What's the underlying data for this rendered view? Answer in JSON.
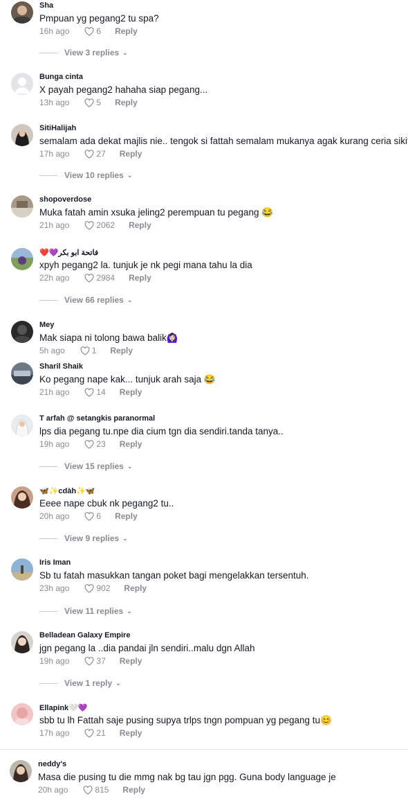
{
  "comments": [
    {
      "user": "Sha",
      "text": "Pmpuan yg pegang2 tu spa?",
      "time": "16h ago",
      "likes": "6",
      "reply": "Reply",
      "view": "View 3 replies"
    },
    {
      "user": "Bunga cinta",
      "text": "X payah pegang2 hahaha siap pegang...",
      "time": "13h ago",
      "likes": "5",
      "reply": "Reply"
    },
    {
      "user": "SitiHalijah",
      "text": "semalam ada dekat majlis nie.. tengok si fattah semalam mukanya agak kurang ceria sikit",
      "time": "17h ago",
      "likes": "27",
      "reply": "Reply",
      "view": "View 10 replies"
    },
    {
      "user": "shopoverdose",
      "text": "Muka fatah amin xsuka jeling2 perempuan tu pegang 😂",
      "time": "21h ago",
      "likes": "2062",
      "reply": "Reply"
    },
    {
      "user": "❤️💜فاتحة ابو بكر",
      "text": "xpyh pegang2 la. tunjuk je nk pegi mana tahu la dia",
      "time": "22h ago",
      "likes": "2984",
      "reply": "Reply",
      "view": "View 66 replies"
    },
    {
      "user": "Mey",
      "text": "Mak siapa ni tolong bawa balik🙆🏻‍♀️",
      "time": "5h ago",
      "likes": "1",
      "reply": "Reply"
    },
    {
      "user": "Sharil Shaik",
      "text": "Ko pegang nape kak... tunjuk arah saja 😂",
      "time": "21h ago",
      "likes": "14",
      "reply": "Reply"
    },
    {
      "user": "T arfah @ setangkis paranormal",
      "text": "lps dia pegang tu.npe dia cium tgn dia sendiri.tanda tanya..",
      "time": "19h ago",
      "likes": "23",
      "reply": "Reply",
      "view": "View 15 replies"
    },
    {
      "user": "🦋✨cdàh✨🦋",
      "text": "Eeee nape cbuk nk pegang2 tu..",
      "time": "20h ago",
      "likes": "6",
      "reply": "Reply",
      "view": "View 9 replies"
    },
    {
      "user": "Iris Iman",
      "text": "Sb tu fatah masukkan tangan poket bagi mengelakkan tersentuh.",
      "time": "23h ago",
      "likes": "902",
      "reply": "Reply",
      "view": "View 11 replies"
    },
    {
      "user": "Belladean Galaxy Empire",
      "text": "jgn pegang la ..dia pandai jln sendiri..malu dgn Allah",
      "time": "19h ago",
      "likes": "37",
      "reply": "Reply",
      "view": "View 1 reply"
    },
    {
      "user": "Ellapink🤍💜",
      "text": "sbb tu lh Fattah saje pusing supya trlps tngn pompuan yg pegang tu😊",
      "time": "17h ago",
      "likes": "21",
      "reply": "Reply"
    },
    {
      "user": "neddy's",
      "text": "Masa die pusing tu die mmg nak bg tau jgn pgg. Guna body language je",
      "time": "20h ago",
      "likes": "815",
      "reply": "Reply"
    }
  ],
  "colors": {
    "text": "#161823",
    "muted": "#8a8b91",
    "background": "#ffffff"
  },
  "icons": {
    "like": "heart-outline-icon",
    "expand": "chevron-down-icon"
  }
}
